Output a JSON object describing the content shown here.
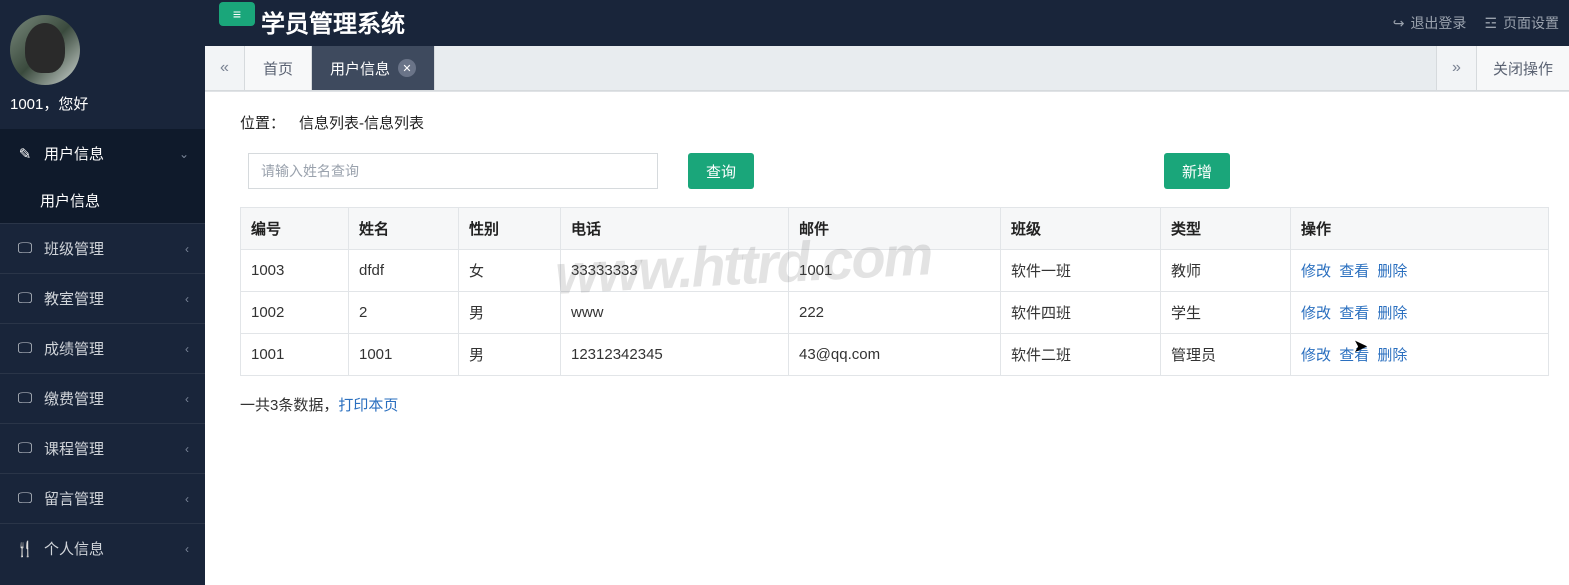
{
  "app": {
    "title": "学员管理系统",
    "greeting": "1001，您好"
  },
  "topbar": {
    "logout": "退出登录",
    "page_settings": "页面设置"
  },
  "sidebar": {
    "items": [
      {
        "label": "用户信息",
        "expanded": true,
        "sub": [
          {
            "label": "用户信息"
          }
        ]
      },
      {
        "label": "班级管理"
      },
      {
        "label": "教室管理"
      },
      {
        "label": "成绩管理"
      },
      {
        "label": "缴费管理"
      },
      {
        "label": "课程管理"
      },
      {
        "label": "留言管理"
      },
      {
        "label": "个人信息"
      }
    ]
  },
  "tabs": {
    "home": "首页",
    "active": "用户信息",
    "close_ops": "关闭操作"
  },
  "breadcrumb": {
    "label": "位置：",
    "path": "信息列表-信息列表"
  },
  "actions": {
    "search_placeholder": "请输入姓名查询",
    "search_btn": "查询",
    "add_btn": "新增"
  },
  "table": {
    "headers": [
      "编号",
      "姓名",
      "性别",
      "电话",
      "邮件",
      "班级",
      "类型",
      "操作"
    ],
    "rows": [
      {
        "id": "1003",
        "name": "dfdf",
        "gender": "女",
        "phone": "33333333",
        "email": "1001",
        "class": "软件一班",
        "type": "教师"
      },
      {
        "id": "1002",
        "name": "2",
        "gender": "男",
        "phone": "www",
        "email": "222",
        "class": "软件四班",
        "type": "学生"
      },
      {
        "id": "1001",
        "name": "1001",
        "gender": "男",
        "phone": "12312342345",
        "email": "43@qq.com",
        "class": "软件二班",
        "type": "管理员"
      }
    ],
    "row_actions": {
      "edit": "修改",
      "view": "查看",
      "delete": "删除"
    }
  },
  "footer": {
    "summary": "一共3条数据，",
    "print": "打印本页"
  },
  "watermark": "www.httrd.com"
}
